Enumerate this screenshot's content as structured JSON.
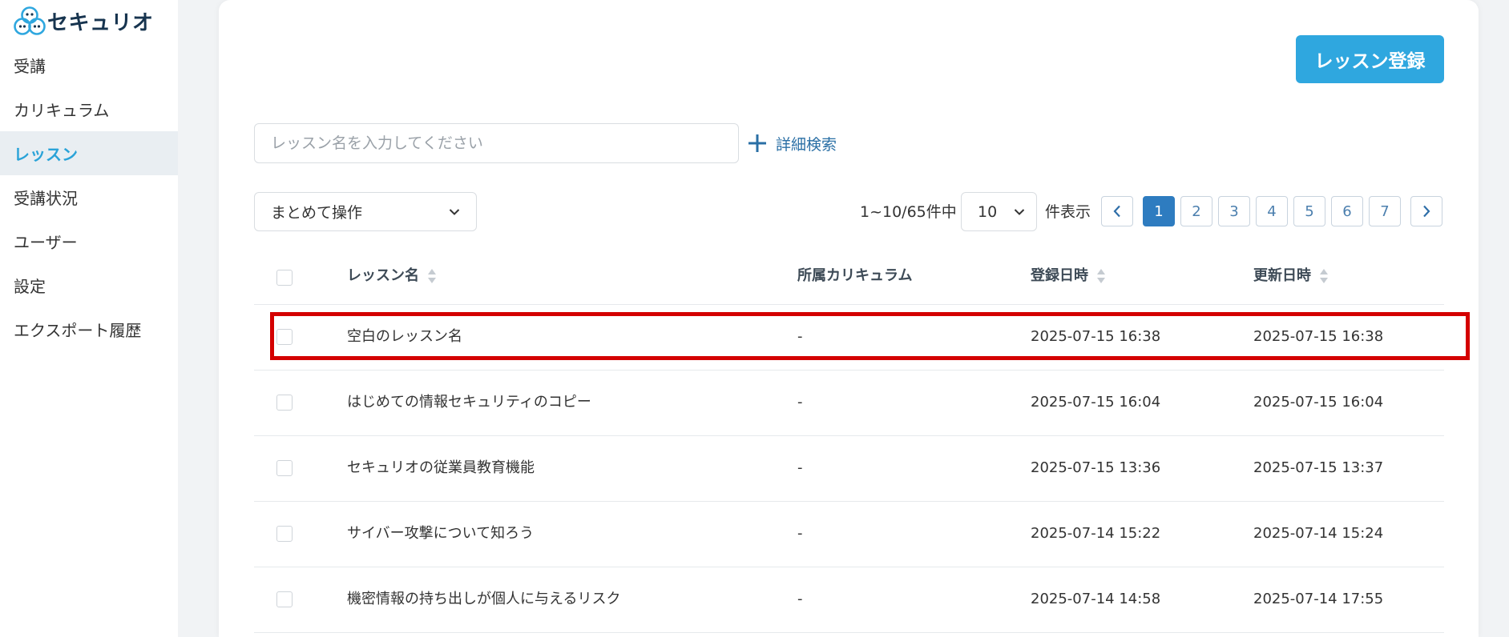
{
  "brand": {
    "name": "セキュリオ",
    "colors": {
      "primary": "#2fa7df",
      "navy": "#17344f",
      "pager_active": "#2e7cc0",
      "highlight": "#d40000"
    }
  },
  "sidebar": {
    "items": [
      {
        "label": "受講"
      },
      {
        "label": "カリキュラム"
      },
      {
        "label": "レッスン",
        "active": true
      },
      {
        "label": "受講状況"
      },
      {
        "label": "ユーザー"
      },
      {
        "label": "設定"
      },
      {
        "label": "エクスポート履歴"
      }
    ]
  },
  "toolbar": {
    "register_label": "レッスン登録",
    "search_placeholder": "レッスン名を入力してください",
    "advanced_search_label": "詳細検索",
    "bulk_action_label": "まとめて操作",
    "range_text": "1~10/65件中",
    "per_page_value": "10",
    "per_page_suffix": "件表示",
    "pages": [
      "1",
      "2",
      "3",
      "4",
      "5",
      "6",
      "7"
    ],
    "current_page": "1"
  },
  "table": {
    "columns": {
      "name": "レッスン名",
      "curriculum": "所属カリキュラム",
      "registered": "登録日時",
      "updated": "更新日時"
    },
    "rows": [
      {
        "name": "空白のレッスン名",
        "curriculum": "-",
        "registered": "2025-07-15 16:38",
        "updated": "2025-07-15 16:38",
        "highlighted": true
      },
      {
        "name": "はじめての情報セキュリティのコピー",
        "curriculum": "-",
        "registered": "2025-07-15 16:04",
        "updated": "2025-07-15 16:04"
      },
      {
        "name": "セキュリオの従業員教育機能",
        "curriculum": "-",
        "registered": "2025-07-15 13:36",
        "updated": "2025-07-15 13:37"
      },
      {
        "name": "サイバー攻撃について知ろう",
        "curriculum": "-",
        "registered": "2025-07-14 15:22",
        "updated": "2025-07-14 15:24"
      },
      {
        "name": "機密情報の持ち出しが個人に与えるリスク",
        "curriculum": "-",
        "registered": "2025-07-14 14:58",
        "updated": "2025-07-14 17:55"
      }
    ]
  }
}
